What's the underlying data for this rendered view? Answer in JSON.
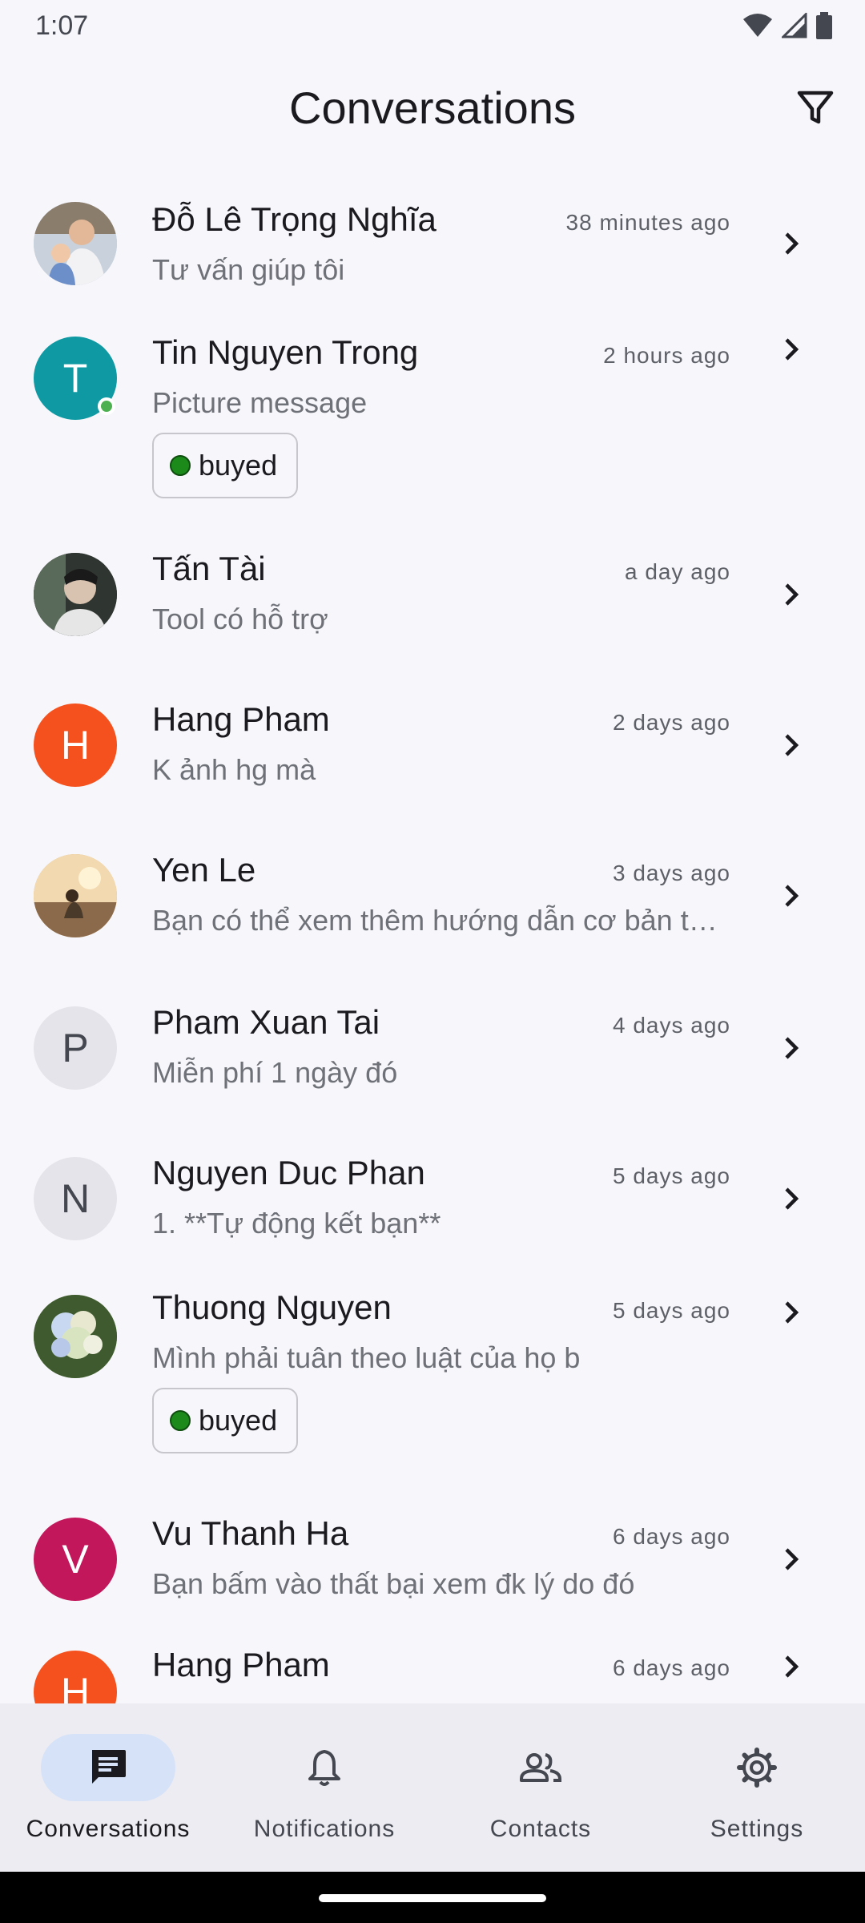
{
  "status_bar": {
    "time": "1:07"
  },
  "app_bar": {
    "title": "Conversations"
  },
  "conversations": [
    {
      "name": "Đỗ Lê Trọng Nghĩa",
      "time": "38 minutes ago",
      "message": "Tư vấn giúp tôi",
      "avatar_type": "photo",
      "avatar_color": "#b9c3cf"
    },
    {
      "name": "Tin Nguyen Trong",
      "time": "2 hours ago",
      "message": "Picture message",
      "avatar_letter": "T",
      "avatar_color": "#0f9aa3",
      "online": true,
      "tag": "buyed"
    },
    {
      "name": "Tấn Tài",
      "time": "a day ago",
      "message": "Tool có hỗ trợ",
      "avatar_type": "photo",
      "avatar_color": "#3a3f3a"
    },
    {
      "name": "Hang Pham",
      "time": "2 days ago",
      "message": "K ảnh hg mà",
      "avatar_letter": "H",
      "avatar_color": "#f4511e"
    },
    {
      "name": "Yen Le",
      "time": "3 days ago",
      "message": "Bạn có thể xem thêm hướng dẫn cơ bản t…",
      "avatar_type": "photo",
      "avatar_color": "#d7a86e"
    },
    {
      "name": "Pham Xuan Tai",
      "time": "4 days ago",
      "message": "Miễn phí 1 ngày đó",
      "avatar_letter": "P",
      "avatar_color": "#e4e4ea"
    },
    {
      "name": "Nguyen Duc Phan",
      "time": "5 days ago",
      "message": "1. **Tự động kết bạn**",
      "avatar_letter": "N",
      "avatar_color": "#e4e4ea"
    },
    {
      "name": "Thuong Nguyen",
      "time": "5 days ago",
      "message": "Mình phải tuân theo luật của họ b",
      "avatar_type": "photo",
      "avatar_color": "#7a9a5a",
      "tag": "buyed"
    },
    {
      "name": "Vu Thanh Ha",
      "time": "6 days ago",
      "message": "Bạn bấm vào thất bại xem đk lý do đó",
      "avatar_letter": "V",
      "avatar_color": "#c2185b"
    },
    {
      "name": "Hang Pham",
      "time": "6 days ago",
      "message": "",
      "avatar_letter": "H",
      "avatar_color": "#f4511e"
    }
  ],
  "bottom_nav": {
    "items": [
      {
        "label": "Conversations",
        "icon": "chat-icon",
        "active": true
      },
      {
        "label": "Notifications",
        "icon": "bell-icon"
      },
      {
        "label": "Contacts",
        "icon": "people-icon"
      },
      {
        "label": "Settings",
        "icon": "gear-icon"
      }
    ]
  }
}
